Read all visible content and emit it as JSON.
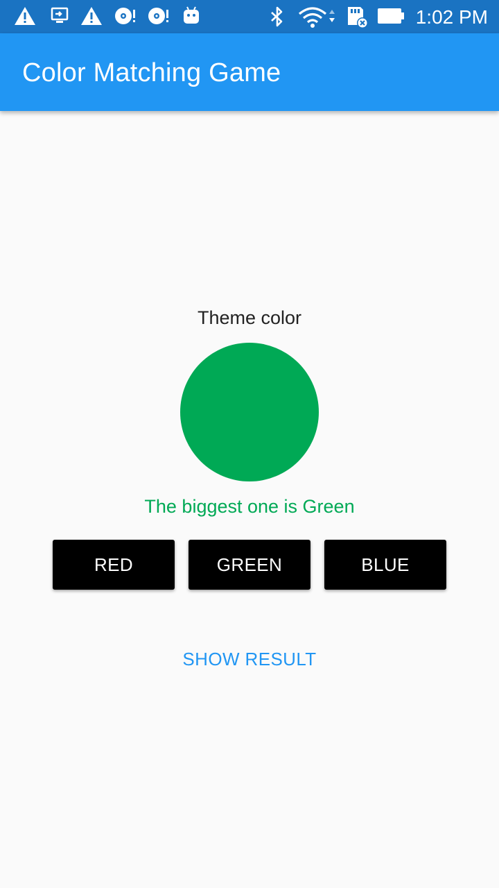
{
  "status_bar": {
    "time": "1:02 PM",
    "icons": [
      "warning-icon",
      "cast-icon",
      "warning-icon",
      "sync-icon",
      "sync-icon",
      "android-icon",
      "bluetooth-icon",
      "wifi-icon",
      "sd-card-icon",
      "battery-icon"
    ]
  },
  "app_bar": {
    "title": "Color Matching Game"
  },
  "game": {
    "theme_label": "Theme color",
    "theme_color": "#00a955",
    "result_text": "The biggest one is Green",
    "result_color": "#00a955",
    "buttons": [
      {
        "label": "RED"
      },
      {
        "label": "GREEN"
      },
      {
        "label": "BLUE"
      }
    ],
    "show_result_label": "SHOW RESULT",
    "show_result_color": "#2196f3"
  },
  "colors": {
    "status_bar": "#1a73c2",
    "app_bar": "#2196f3",
    "background": "#fafafa",
    "button": "#000000"
  }
}
